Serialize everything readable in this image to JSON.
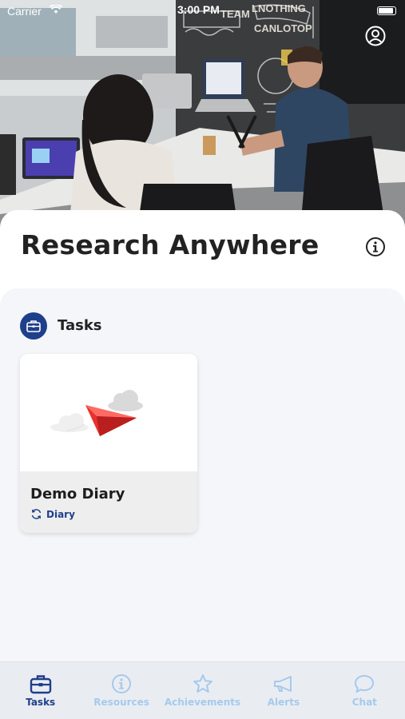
{
  "status_bar": {
    "carrier": "Carrier",
    "time": "3:00 PM"
  },
  "header": {
    "title": "Research Anywhere"
  },
  "icons": {
    "profile": "user-circle-icon",
    "info": "info-circle-icon",
    "section": "briefcase-icon",
    "task_art": "paper-plane-icon",
    "task_type": "refresh-icon"
  },
  "section": {
    "title": "Tasks"
  },
  "tasks": [
    {
      "name": "Demo Diary",
      "type": "Diary"
    }
  ],
  "tab_bar": {
    "tabs": [
      {
        "label": "Tasks",
        "icon": "briefcase-icon",
        "active": true
      },
      {
        "label": "Resources",
        "icon": "info-circle-icon",
        "active": false
      },
      {
        "label": "Achievements",
        "icon": "star-icon",
        "active": false
      },
      {
        "label": "Alerts",
        "icon": "megaphone-icon",
        "active": false
      },
      {
        "label": "Chat",
        "icon": "chat-bubble-icon",
        "active": false
      }
    ]
  },
  "colors": {
    "accent": "#1e3f8a",
    "inactive_tab": "#a7c9ec",
    "tab_bar_bg": "#e9edf2",
    "panel_bg": "#f4f6f9",
    "plane_red": "#e8312f"
  }
}
